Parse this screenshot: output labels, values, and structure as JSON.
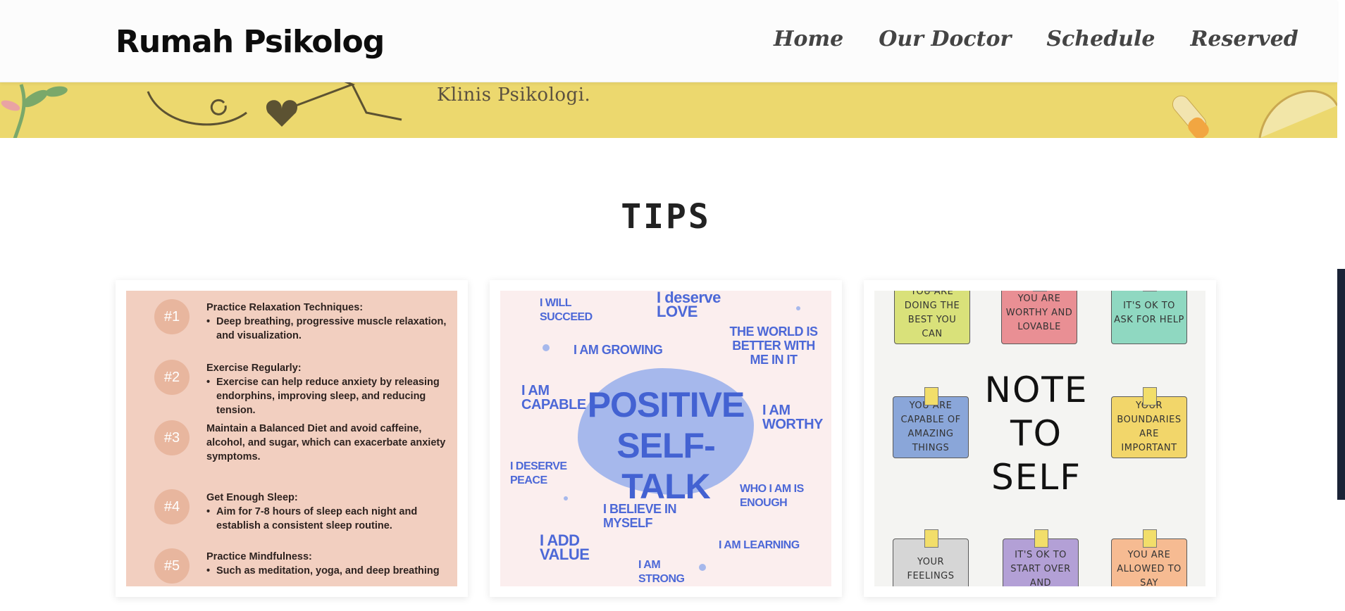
{
  "brand": "Rumah Psikolog",
  "nav": [
    {
      "label": "Home"
    },
    {
      "label": "Our Doctor"
    },
    {
      "label": "Schedule"
    },
    {
      "label": "Reserved"
    }
  ],
  "hero": {
    "subtitle": "Klinis Psikologi."
  },
  "tips_heading": "TIPS",
  "card1": {
    "tips": [
      {
        "num": "#1",
        "title": "Practice Relaxation Techniques:",
        "bullet": "Deep breathing, progressive muscle relaxation, and visualization."
      },
      {
        "num": "#2",
        "title": "Exercise Regularly:",
        "bullet": "Exercise can help reduce anxiety by releasing endorphins, improving sleep, and reducing tension."
      },
      {
        "num": "#3",
        "title": "Maintain a Balanced Diet and avoid caffeine, alcohol, and sugar, which can exacerbate anxiety symptoms.",
        "bullet": ""
      },
      {
        "num": "#4",
        "title": "Get Enough Sleep:",
        "bullet": "Aim for 7-8 hours of sleep each night and establish a consistent sleep routine."
      },
      {
        "num": "#5",
        "title": "Practice Mindfulness:",
        "bullet": "Such as meditation, yoga, and deep breathing"
      }
    ]
  },
  "card2": {
    "title_line1": "POSITIVE",
    "title_line2": "SELF-TALK",
    "affirmations": [
      "I WILL SUCCEED",
      "I deserve LOVE",
      "I AM GROWING",
      "THE WORLD IS BETTER WITH ME IN IT",
      "I AM CAPABLE",
      "I AM WORTHY",
      "I DESERVE PEACE",
      "WHO I AM IS ENOUGH",
      "I BELIEVE IN MYSELF",
      "I ADD VALUE",
      "I AM LEARNING",
      "I AM STRONG"
    ]
  },
  "card3": {
    "center_text": "NOTE TO SELF",
    "notes": [
      "YOU ARE DOING THE BEST YOU CAN",
      "YOU ARE WORTHY AND LOVABLE",
      "IT'S OK TO ASK FOR HELP",
      "YOU ARE CAPABLE OF AMAZING THINGS",
      "YOUR BOUNDARIES ARE IMPORTANT",
      "YOUR FEELINGS",
      "IT'S OK TO START OVER AND",
      "YOU ARE ALLOWED TO SAY"
    ],
    "note_colors": [
      "#d9e17a",
      "#e98f94",
      "#8fd8c1",
      "#8aa6d9",
      "#f2d66a",
      "#d6d6d6",
      "#b3a0d6",
      "#f6bb92"
    ]
  },
  "colors": {
    "hero_bg": "#ecd86e",
    "tip_card_bg": "#f2cfc0",
    "tip_circle": "#e8b69e",
    "affirmation_blue": "#4c68d7",
    "side_bar": "#1a2336"
  }
}
